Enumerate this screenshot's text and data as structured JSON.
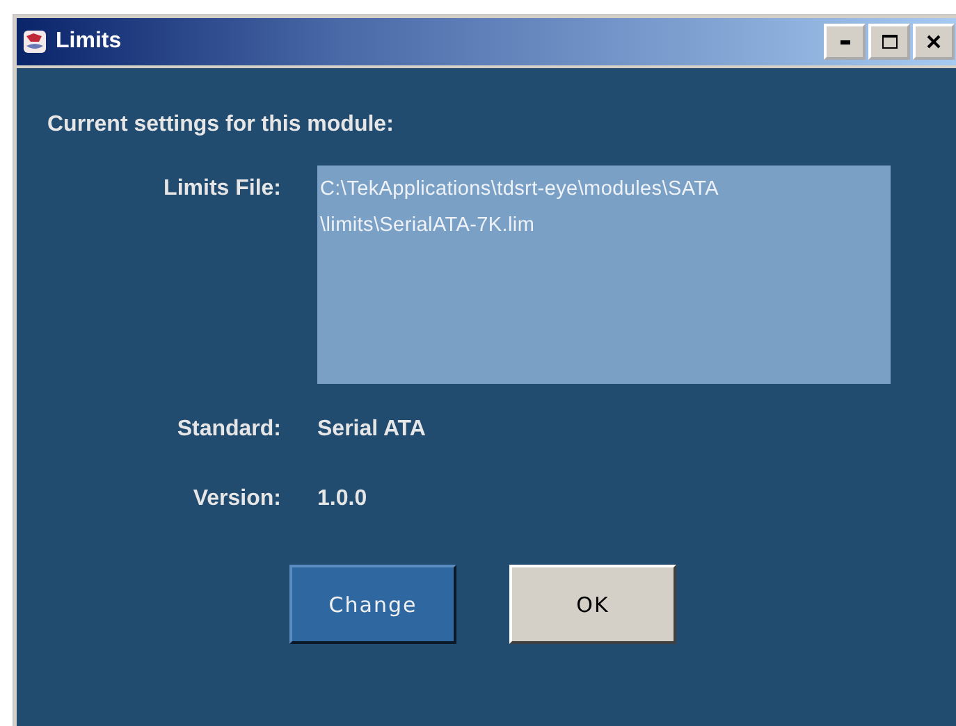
{
  "window": {
    "title": "Limits"
  },
  "heading": "Current settings for this module:",
  "limits_file": {
    "label": "Limits File:",
    "lines": [
      "C:\\TekApplications\\tdsrt-eye\\modules\\SATA",
      "\\limits\\SerialATA-7K.lim"
    ]
  },
  "fields": [
    {
      "label": "Standard:",
      "value": "Serial ATA"
    },
    {
      "label": "Version:",
      "value": "1.0.0"
    }
  ],
  "buttons": [
    {
      "label": "Change",
      "kind": "accent"
    },
    {
      "label": "OK",
      "kind": "plain"
    }
  ]
}
